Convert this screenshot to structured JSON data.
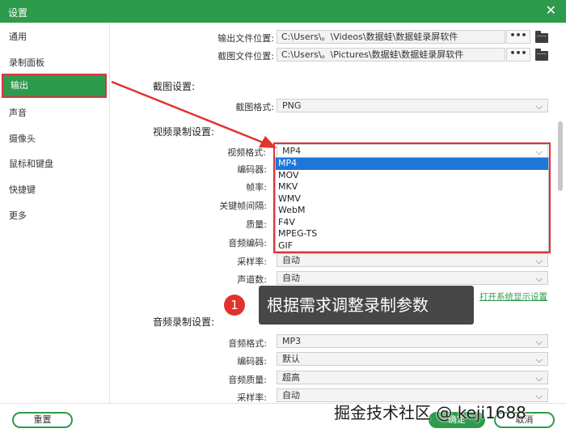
{
  "window": {
    "title": "设置",
    "close": "✕"
  },
  "sidebar": {
    "items": [
      {
        "label": "通用"
      },
      {
        "label": "录制面板"
      },
      {
        "label": "输出"
      },
      {
        "label": "声音"
      },
      {
        "label": "摄像头"
      },
      {
        "label": "鼠标和键盘"
      },
      {
        "label": "快捷键"
      },
      {
        "label": "更多"
      }
    ],
    "active_index": 2
  },
  "output": {
    "output_path_label": "输出文件位置:",
    "output_path_value": "C:\\Users\\。\\Videos\\数据蛙\\数据蛙录屏软件",
    "screenshot_path_label": "截图文件位置:",
    "screenshot_path_value": "C:\\Users\\。\\Pictures\\数据蛙\\数据蛙录屏软件",
    "dots": "•••"
  },
  "screenshot_settings": {
    "title": "截图设置:",
    "format_label": "截图格式:",
    "format_value": "PNG"
  },
  "video_settings": {
    "title": "视频录制设置:",
    "format_label": "视频格式:",
    "format_value": "MP4",
    "encoder_label": "编码器:",
    "framerate_label": "帧率:",
    "keyframe_label": "关键帧间隔:",
    "quality_label": "质量:",
    "audio_codec_label": "音频编码:",
    "samplerate_label": "采样率:",
    "samplerate_value": "自动",
    "channels_label": "声道数:",
    "channels_value": "自动",
    "format_options": [
      "MP4",
      "MOV",
      "MKV",
      "WMV",
      "WebM",
      "F4V",
      "MPEG-TS",
      "GIF"
    ]
  },
  "annotation": {
    "badge": "1",
    "callout": "根据需求调整录制参数",
    "link": "打开系统显示设置"
  },
  "audio_settings": {
    "title": "音频录制设置:",
    "format_label": "音频格式:",
    "format_value": "MP3",
    "encoder_label": "编码器:",
    "encoder_value": "默认",
    "quality_label": "音频质量:",
    "quality_value": "超高",
    "samplerate_label": "采样率:",
    "samplerate_value": "自动"
  },
  "footer": {
    "reset": "重置",
    "confirm": "确定",
    "cancel": "取消"
  },
  "watermark": "掘金技术社区 @ keji1688",
  "chevron": "⌵",
  "colors": {
    "accent": "#2e9a4b",
    "highlight": "#d9363e",
    "selection": "#1e76d7"
  }
}
